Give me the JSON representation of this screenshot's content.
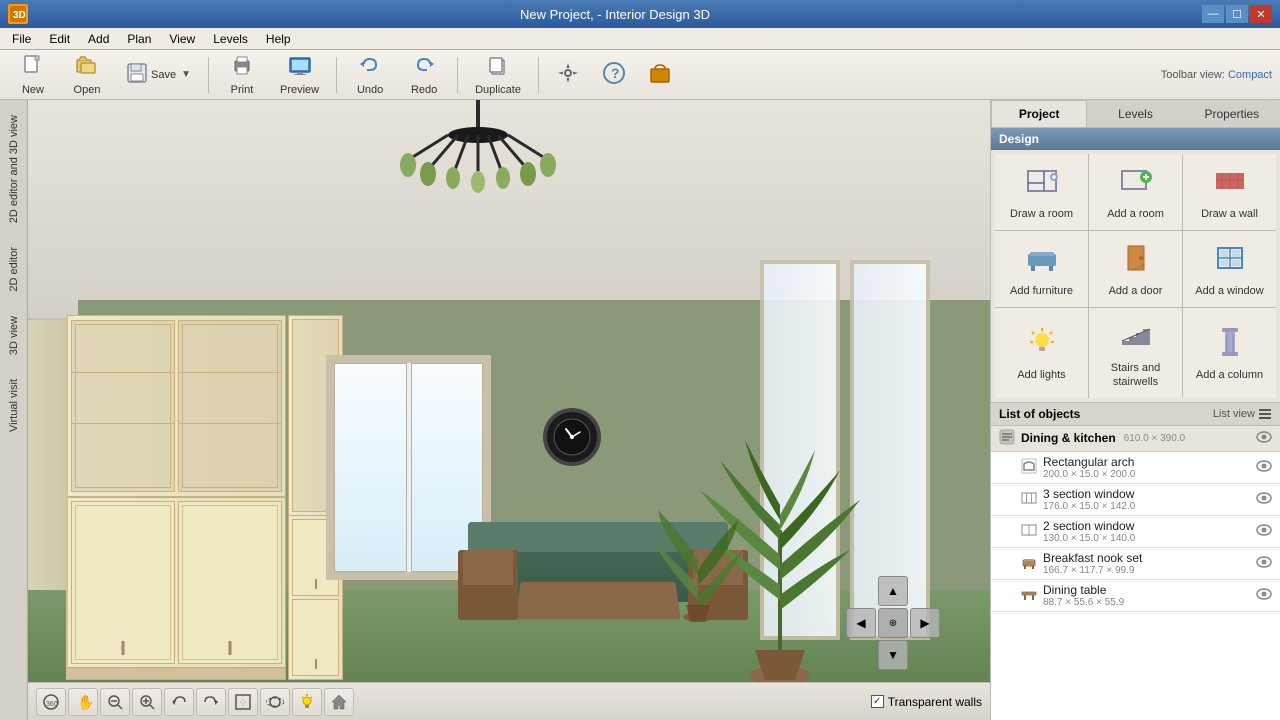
{
  "window": {
    "title": "New Project, - Interior Design 3D"
  },
  "titlebar": {
    "title": "New Project, - Interior Design 3D",
    "minimize": "—",
    "maximize": "☐",
    "close": "✕"
  },
  "menubar": {
    "items": [
      "File",
      "Edit",
      "Add",
      "Plan",
      "View",
      "Levels",
      "Help"
    ]
  },
  "toolbar": {
    "new_label": "New",
    "open_label": "Open",
    "save_label": "Save",
    "print_label": "Print",
    "preview_label": "Preview",
    "undo_label": "Undo",
    "redo_label": "Redo",
    "duplicate_label": "Duplicate",
    "settings_label": "Settings",
    "help_label": "Help",
    "shop_label": "Shop",
    "toolbar_view_label": "Toolbar view:",
    "compact_label": "Compact"
  },
  "side_tabs": {
    "items": [
      "2D editor and 3D view",
      "2D editor",
      "3D view",
      "Virtual visit"
    ]
  },
  "viewport": {
    "transparent_walls_label": "Transparent walls",
    "transparent_walls_checked": true
  },
  "nav_buttons": [
    {
      "icon": "⊕",
      "label": "360"
    },
    {
      "icon": "✋",
      "label": "pan"
    },
    {
      "icon": "🔍",
      "label": "zoom-out"
    },
    {
      "icon": "🔍",
      "label": "zoom-in"
    },
    {
      "icon": "↺",
      "label": "undo-view"
    },
    {
      "icon": "↻",
      "label": "redo-view"
    },
    {
      "icon": "⬚",
      "label": "frame"
    },
    {
      "icon": "⊙",
      "label": "orbit"
    },
    {
      "icon": "💡",
      "label": "lights"
    },
    {
      "icon": "⌂",
      "label": "home"
    }
  ],
  "right_panel": {
    "tabs": [
      "Project",
      "Levels",
      "Properties"
    ],
    "active_tab": "Project",
    "design_section_title": "Design",
    "design_items": [
      {
        "icon": "draw-room",
        "label": "Draw a room"
      },
      {
        "icon": "add-room",
        "label": "Add a room"
      },
      {
        "icon": "draw-wall",
        "label": "Draw a wall"
      },
      {
        "icon": "add-furniture",
        "label": "Add furniture"
      },
      {
        "icon": "add-door",
        "label": "Add a door"
      },
      {
        "icon": "add-window",
        "label": "Add a window"
      },
      {
        "icon": "add-lights",
        "label": "Add lights"
      },
      {
        "icon": "stairs-stairwells",
        "label": "Stairs and stairwells"
      },
      {
        "icon": "add-column",
        "label": "Add a column"
      }
    ],
    "list_section_title": "List of objects",
    "list_view_label": "List view",
    "objects": [
      {
        "type": "group",
        "name": "Dining & kitchen",
        "dims": "610.0 × 390.0",
        "items": [
          {
            "name": "Rectangular arch",
            "dims": "200.0 × 15.0 × 200.0"
          },
          {
            "name": "3 section window",
            "dims": "176.0 × 15.0 × 142.0"
          },
          {
            "name": "2 section window",
            "dims": "130.0 × 15.0 × 140.0"
          },
          {
            "name": "Breakfast nook set",
            "dims": "166.7 × 117.7 × 99.9"
          },
          {
            "name": "Dining table",
            "dims": "88.7 × 55.6 × 55.9"
          }
        ]
      }
    ]
  }
}
